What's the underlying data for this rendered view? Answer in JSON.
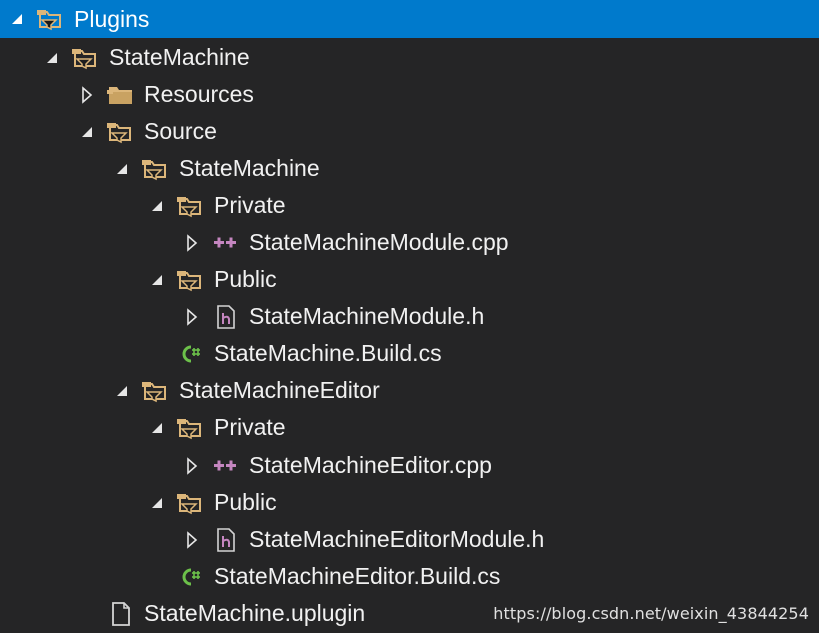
{
  "tree": {
    "items": [
      {
        "label": "Plugins",
        "icon": "folder-filter-icon",
        "expander": "expanded",
        "selected": true
      },
      {
        "label": "StateMachine",
        "icon": "folder-filter-icon",
        "expander": "expanded"
      },
      {
        "label": "Resources",
        "icon": "folder-filled-icon",
        "expander": "collapsed"
      },
      {
        "label": "Source",
        "icon": "folder-filter-icon",
        "expander": "expanded"
      },
      {
        "label": "StateMachine",
        "icon": "folder-filter-icon",
        "expander": "expanded"
      },
      {
        "label": "Private",
        "icon": "folder-filter-icon",
        "expander": "expanded"
      },
      {
        "label": "StateMachineModule.cpp",
        "icon": "cpp-file-icon",
        "expander": "collapsed"
      },
      {
        "label": "Public",
        "icon": "folder-filter-icon",
        "expander": "expanded"
      },
      {
        "label": "StateMachineModule.h",
        "icon": "header-file-icon",
        "expander": "collapsed"
      },
      {
        "label": "StateMachine.Build.cs",
        "icon": "csharp-file-icon",
        "expander": "none"
      },
      {
        "label": "StateMachineEditor",
        "icon": "folder-filter-icon",
        "expander": "expanded"
      },
      {
        "label": "Private",
        "icon": "folder-filter-icon",
        "expander": "expanded"
      },
      {
        "label": "StateMachineEditor.cpp",
        "icon": "cpp-file-icon",
        "expander": "collapsed"
      },
      {
        "label": "Public",
        "icon": "folder-filter-icon",
        "expander": "expanded"
      },
      {
        "label": "StateMachineEditorModule.h",
        "icon": "header-file-icon",
        "expander": "collapsed"
      },
      {
        "label": "StateMachineEditor.Build.cs",
        "icon": "csharp-file-icon",
        "expander": "none"
      },
      {
        "label": "StateMachine.uplugin",
        "icon": "document-file-icon",
        "expander": "none"
      }
    ]
  },
  "watermark": "https://blog.csdn.net/weixin_43844254",
  "colors": {
    "background": "#252526",
    "selection": "#007acc",
    "text": "#f1f1f1",
    "folder": "#dcb67a",
    "cpp": "#c586c0",
    "csharp": "#6cc04a"
  }
}
